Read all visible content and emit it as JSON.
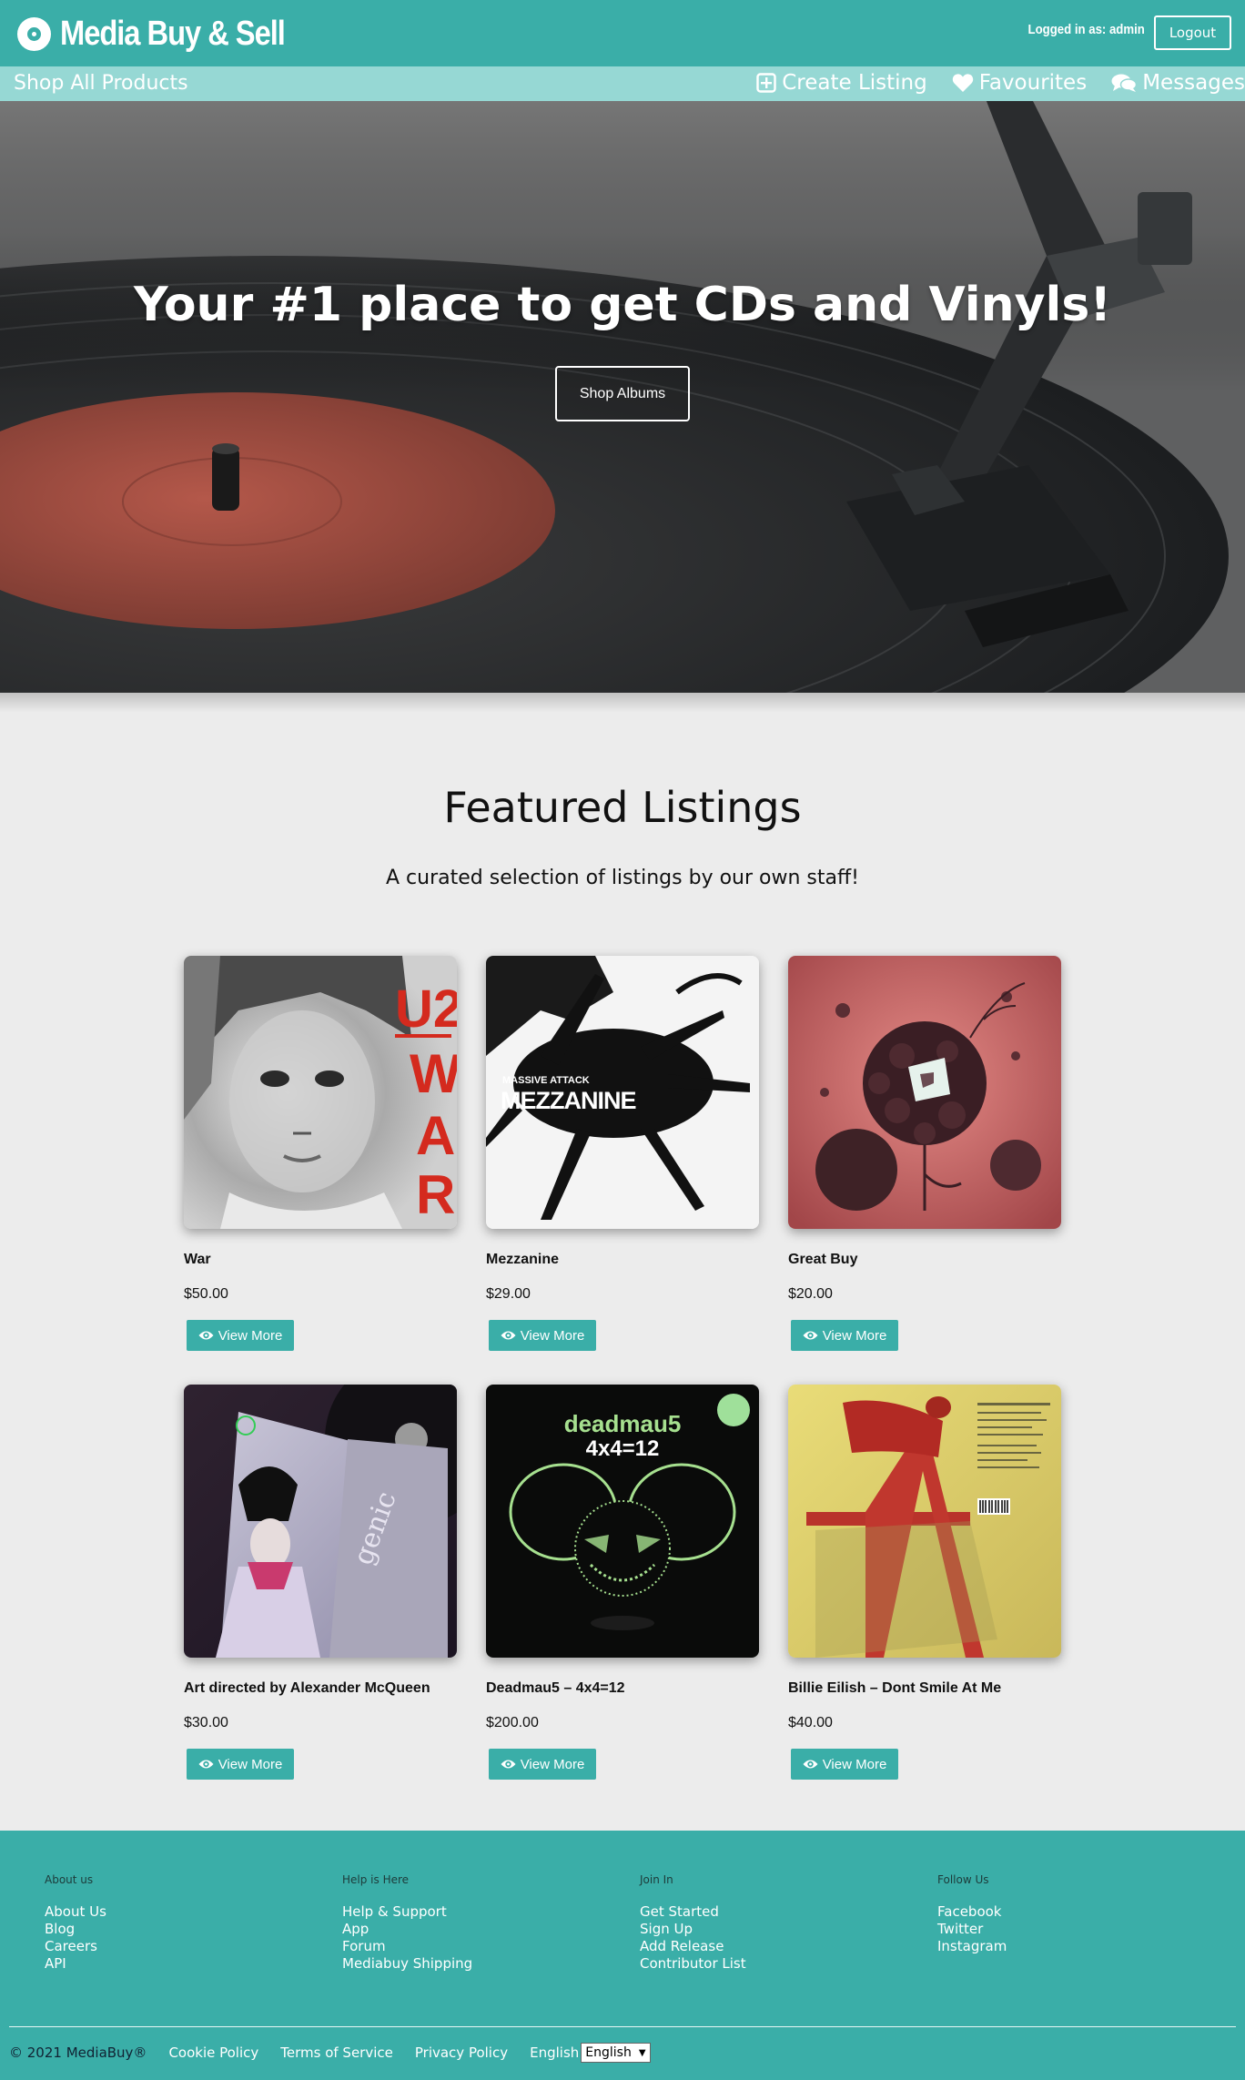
{
  "header": {
    "brand": "Media Buy & Sell",
    "login_text": "Logged in as: admin",
    "logout_label": "Logout",
    "accent_color": "#3aaea8"
  },
  "subnav": {
    "shop_all": "Shop All Products",
    "items": [
      {
        "label": "Create Listing",
        "icon": "plus-square-icon"
      },
      {
        "label": "Favourites",
        "icon": "heart-icon"
      },
      {
        "label": "Messages",
        "icon": "comments-icon"
      }
    ]
  },
  "hero": {
    "title": "Your #1 place to get CDs and Vinyls!",
    "button_label": "Shop Albums"
  },
  "featured": {
    "title": "Featured Listings",
    "subtitle": "A curated selection of listings by our own staff!",
    "view_label": "View More",
    "listings": [
      {
        "title": "War",
        "price": "$50.00"
      },
      {
        "title": "Mezzanine",
        "price": "$29.00"
      },
      {
        "title": "Great Buy",
        "price": "$20.00"
      },
      {
        "title": "Art directed by Alexander McQueen",
        "price": "$30.00"
      },
      {
        "title": "Deadmau5 – 4x4=12",
        "price": "$200.00"
      },
      {
        "title": "Billie Eilish – Dont Smile At Me",
        "price": "$40.00"
      }
    ],
    "cover_text": {
      "u2_band": "U2",
      "u2_album": "WAR",
      "mezz_artist": "MASSIVE ATTACK",
      "mezz_album": "MEZZANINE",
      "deadmau5_artist": "deadmau5",
      "deadmau5_album": "4x4=12",
      "bjork_text": "genic"
    }
  },
  "footer": {
    "columns": [
      {
        "heading": "About us",
        "links": [
          "About Us",
          "Blog",
          "Careers",
          "API"
        ]
      },
      {
        "heading": "Help is Here",
        "links": [
          "Help & Support",
          "App",
          "Forum",
          "Mediabuy Shipping"
        ]
      },
      {
        "heading": "Join In",
        "links": [
          "Get Started",
          "Sign Up",
          "Add Release",
          "Contributor List"
        ]
      },
      {
        "heading": "Follow Us",
        "links": [
          "Facebook",
          "Twitter",
          "Instagram"
        ]
      }
    ],
    "copyright": "© 2021 MediaBuy®",
    "bottom_links": [
      "Cookie Policy",
      "Terms of Service",
      "Privacy Policy"
    ],
    "language_label": "English",
    "language_selected": "English"
  }
}
